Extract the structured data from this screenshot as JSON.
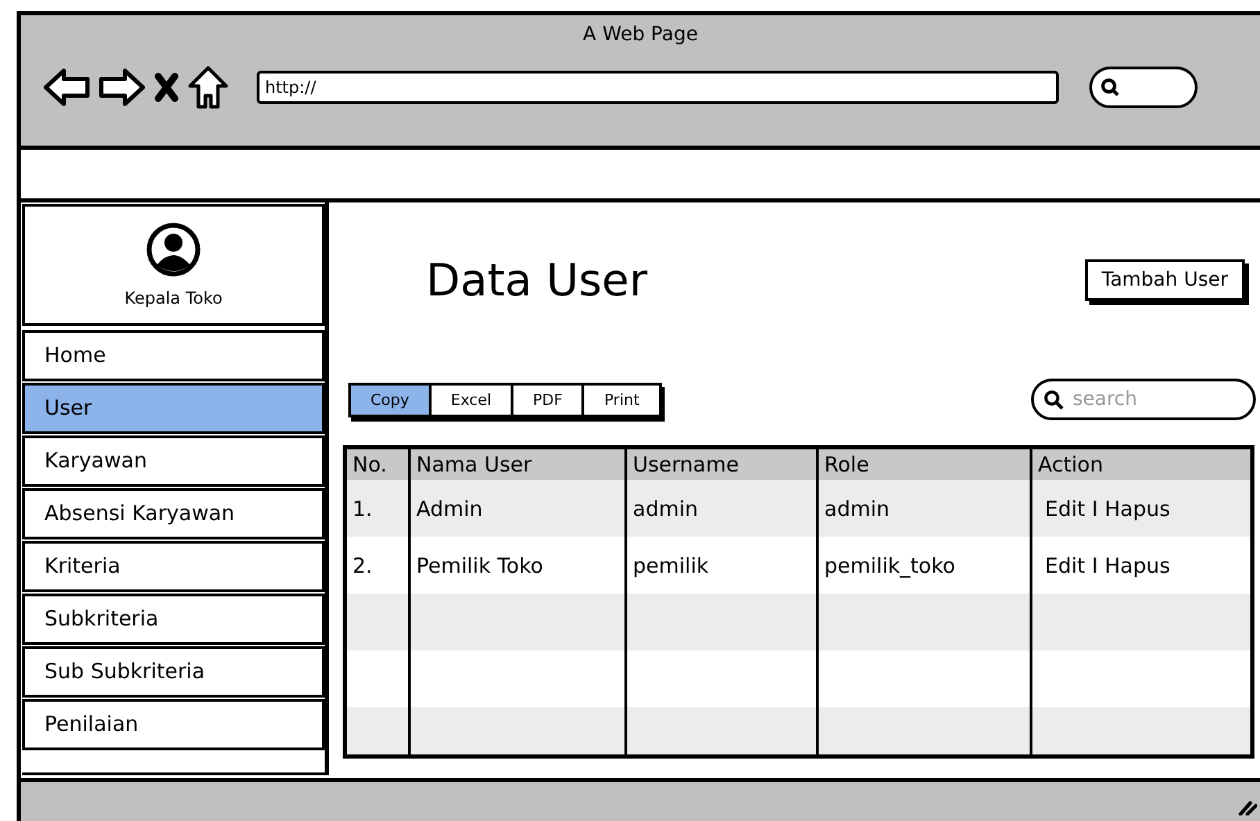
{
  "window": {
    "title": "A Web Page"
  },
  "address_bar": {
    "value": "http://"
  },
  "sidebar": {
    "profile": {
      "name": "Kepala Toko"
    },
    "items": [
      {
        "label": "Home",
        "selected": false
      },
      {
        "label": "User",
        "selected": true
      },
      {
        "label": "Karyawan",
        "selected": false
      },
      {
        "label": "Absensi Karyawan",
        "selected": false
      },
      {
        "label": "Kriteria",
        "selected": false
      },
      {
        "label": "Subkriteria",
        "selected": false
      },
      {
        "label": "Sub Subkriteria",
        "selected": false
      },
      {
        "label": "Penilaian",
        "selected": false
      }
    ]
  },
  "page": {
    "title": "Data User",
    "add_button": "Tambah User"
  },
  "export_buttons": [
    {
      "label": "Copy",
      "selected": true
    },
    {
      "label": "Excel",
      "selected": false
    },
    {
      "label": "PDF",
      "selected": false
    },
    {
      "label": "Print",
      "selected": false
    }
  ],
  "search": {
    "placeholder": "search"
  },
  "table": {
    "columns": [
      "No.",
      "Nama User",
      "Username",
      "Role",
      "Action"
    ],
    "rows": [
      [
        "1.",
        "Admin",
        "admin",
        "admin",
        "Edit I Hapus"
      ],
      [
        "2.",
        "Pemilik Toko",
        "pemilik",
        "pemilik_toko",
        "Edit I Hapus"
      ]
    ]
  }
}
